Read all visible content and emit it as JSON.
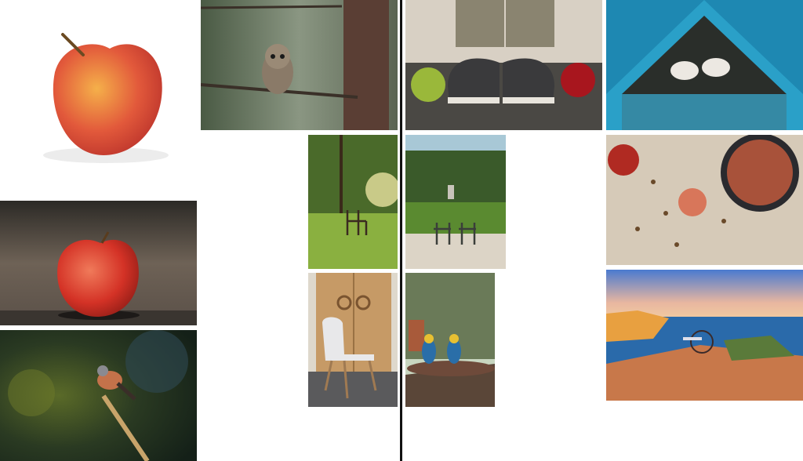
{
  "tiles": [
    {
      "id": "red-apple-white-background",
      "subject": "apple-icon"
    },
    {
      "id": "owl-on-branch",
      "subject": "owl-icon"
    },
    {
      "id": "sneakers-with-apples",
      "subject": "sneaker-icon"
    },
    {
      "id": "doves-blue-window",
      "subject": "dove-icon"
    },
    {
      "id": "red-apple-on-road",
      "subject": "apple-icon"
    },
    {
      "id": "chair-in-sunny-park",
      "subject": "chair-icon"
    },
    {
      "id": "two-chairs-in-park",
      "subject": "chair-icon"
    },
    {
      "id": "apples-nuts-on-cloth",
      "subject": "apple-icon"
    },
    {
      "id": "bird-on-stick",
      "subject": "bird-icon"
    },
    {
      "id": "white-chair-wooden-door",
      "subject": "chair-icon"
    },
    {
      "id": "parrots-on-stump",
      "subject": "parrot-icon"
    },
    {
      "id": "seaside-cliff-table",
      "subject": "sea-icon"
    }
  ],
  "colors": {
    "background": "#ffffff",
    "divider": "#111111"
  }
}
